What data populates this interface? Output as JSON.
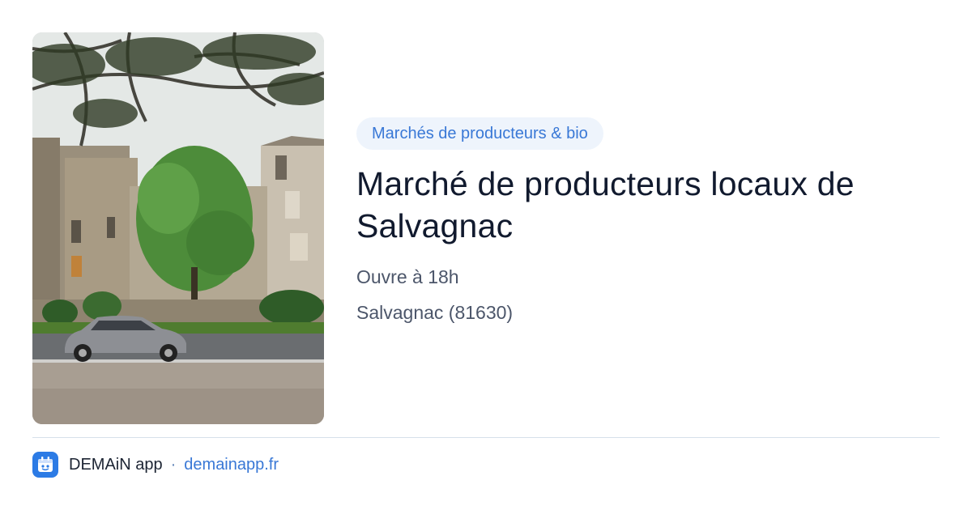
{
  "card": {
    "category": "Marchés de producteurs & bio",
    "title": "Marché de producteurs locaux de Salvagnac",
    "hours": "Ouvre à 18h",
    "location": "Salvagnac (81630)"
  },
  "footer": {
    "app_name": "DEMAiN app",
    "separator": "·",
    "domain": "demainapp.fr"
  },
  "icons": {
    "app": "demain-app-logo-icon"
  },
  "colors": {
    "accent": "#3978d6",
    "badge_bg": "#eef4fc",
    "title": "#111a2e",
    "meta": "#4c566a",
    "app_icon_bg": "#2c7be5"
  }
}
